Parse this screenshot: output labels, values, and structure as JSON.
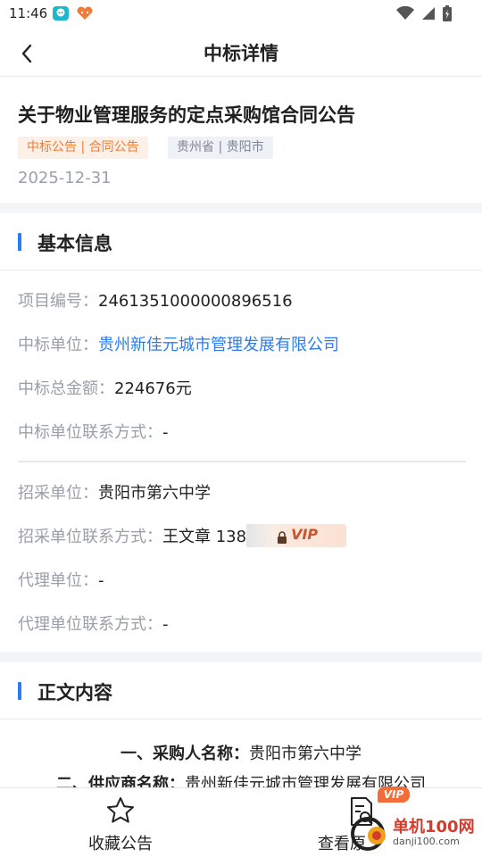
{
  "status_bar": {
    "time": "11:46"
  },
  "nav": {
    "title": "中标详情"
  },
  "header": {
    "title": "关于物业管理服务的定点采购馆合同公告",
    "tag_type": "中标公告 | 合同公告",
    "tag_region": "贵州省 | 贵阳市",
    "date": "2025-12-31"
  },
  "basic_info": {
    "section_title": "基本信息",
    "project_no": {
      "label": "项目编号：",
      "value": "2461351000000896516"
    },
    "winner": {
      "label": "中标单位：",
      "value": "贵州新佳元城市管理发展有限公司"
    },
    "amount": {
      "label": "中标总金额：",
      "value": "224676元"
    },
    "winner_contact": {
      "label": "中标单位联系方式：",
      "value": "-"
    },
    "buyer": {
      "label": "招采单位：",
      "value": "贵阳市第六中学"
    },
    "buyer_contact": {
      "label": "招采单位联系方式：",
      "value": "王文章 138",
      "vip": "VIP"
    },
    "agent": {
      "label": "代理单位：",
      "value": "-"
    },
    "agent_contact": {
      "label": "代理单位联系方式：",
      "value": "-"
    }
  },
  "content": {
    "section_title": "正文内容",
    "line1_label": "一、采购人名称：",
    "line1_value": "贵阳市第六中学",
    "line2_label": "二、供应商名称：",
    "line2_value": "贵州新佳元城市管理发展有限公司"
  },
  "bottom_bar": {
    "favorite_label": "收藏公告",
    "view_label": "查看原",
    "vip_badge": "VIP"
  },
  "watermark": {
    "title": "单机100网",
    "url": "danji100.com"
  },
  "colors": {
    "accent": "#2a7df0",
    "tag_orange": "#ef7d36",
    "vip_orange": "#f26d3a"
  }
}
